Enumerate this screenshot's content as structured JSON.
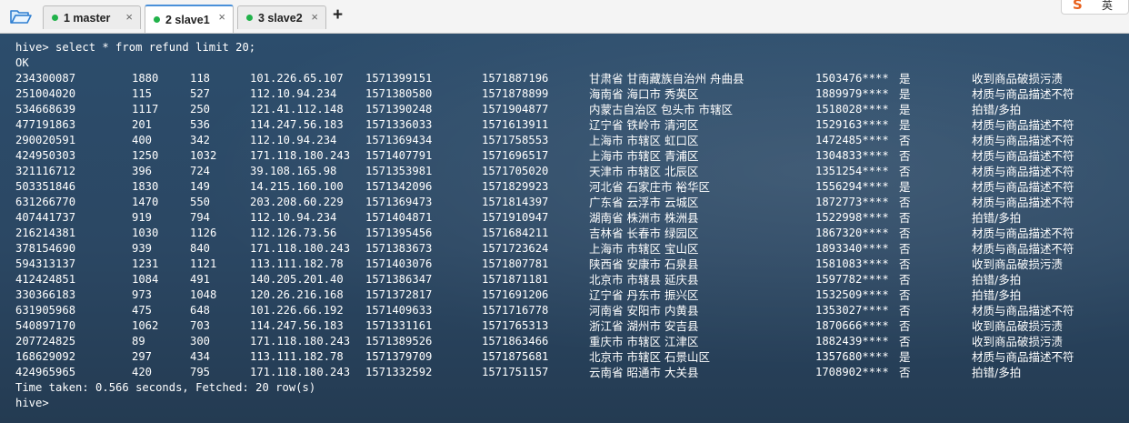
{
  "tabs": [
    {
      "label": "1 master",
      "status": "connected",
      "active": false
    },
    {
      "label": "2 slave1",
      "status": "connected",
      "active": true
    },
    {
      "label": "3 slave2",
      "status": "connected",
      "active": false
    }
  ],
  "tab_close_glyph": "×",
  "add_tab_glyph": "+",
  "ime_indicator": {
    "logo": "S",
    "text": "英"
  },
  "colors": {
    "status_dot": "#21b24a",
    "active_tab_accent": "#4a90d9",
    "terminal_bg": "#2a4560",
    "terminal_text": "#ffffff"
  },
  "terminal": {
    "command": "hive> select * from refund limit 20;",
    "ok": "OK",
    "rows": [
      [
        "234300087",
        "1880",
        "118",
        "101.226.65.107",
        "1571399151",
        "1571887196",
        "甘肃省 甘南藏族自治州 舟曲县",
        "1503476****",
        "是",
        "收到商品破损污渍"
      ],
      [
        "251004020",
        "115",
        "527",
        "112.10.94.234",
        "1571380580",
        "1571878899",
        "海南省 海口市 秀英区",
        "1889979****",
        "是",
        "材质与商品描述不符"
      ],
      [
        "534668639",
        "1117",
        "250",
        "121.41.112.148",
        "1571390248",
        "1571904877",
        "内蒙古自治区 包头市 市辖区",
        "1518028****",
        "是",
        "拍错/多拍"
      ],
      [
        "477191863",
        "201",
        "536",
        "114.247.56.183",
        "1571336033",
        "1571613911",
        "辽宁省 铁岭市 清河区",
        "1529163****",
        "是",
        "材质与商品描述不符"
      ],
      [
        "290020591",
        "400",
        "342",
        "112.10.94.234",
        "1571369434",
        "1571758553",
        "上海市 市辖区 虹口区",
        "1472485****",
        "否",
        "材质与商品描述不符"
      ],
      [
        "424950303",
        "1250",
        "1032",
        "171.118.180.243",
        "1571407791",
        "1571696517",
        "上海市 市辖区 青浦区",
        "1304833****",
        "否",
        "材质与商品描述不符"
      ],
      [
        "321116712",
        "396",
        "724",
        "39.108.165.98",
        "1571353981",
        "1571705020",
        "天津市 市辖区 北辰区",
        "1351254****",
        "否",
        "材质与商品描述不符"
      ],
      [
        "503351846",
        "1830",
        "149",
        "14.215.160.100",
        "1571342096",
        "1571829923",
        "河北省 石家庄市 裕华区",
        "1556294****",
        "是",
        "材质与商品描述不符"
      ],
      [
        "631266770",
        "1470",
        "550",
        "203.208.60.229",
        "1571369473",
        "1571814397",
        "广东省 云浮市 云城区",
        "1872773****",
        "否",
        "材质与商品描述不符"
      ],
      [
        "407441737",
        "919",
        "794",
        "112.10.94.234",
        "1571404871",
        "1571910947",
        "湖南省 株洲市 株洲县",
        "1522998****",
        "否",
        "拍错/多拍"
      ],
      [
        "216214381",
        "1030",
        "1126",
        "112.126.73.56",
        "1571395456",
        "1571684211",
        "吉林省 长春市 绿园区",
        "1867320****",
        "否",
        "材质与商品描述不符"
      ],
      [
        "378154690",
        "939",
        "840",
        "171.118.180.243",
        "1571383673",
        "1571723624",
        "上海市 市辖区 宝山区",
        "1893340****",
        "否",
        "材质与商品描述不符"
      ],
      [
        "594313137",
        "1231",
        "1121",
        "113.111.182.78",
        "1571403076",
        "1571807781",
        "陕西省 安康市 石泉县",
        "1581083****",
        "否",
        "收到商品破损污渍"
      ],
      [
        "412424851",
        "1084",
        "491",
        "140.205.201.40",
        "1571386347",
        "1571871181",
        "北京市 市辖县 延庆县",
        "1597782****",
        "否",
        "拍错/多拍"
      ],
      [
        "330366183",
        "973",
        "1048",
        "120.26.216.168",
        "1571372817",
        "1571691206",
        "辽宁省 丹东市 振兴区",
        "1532509****",
        "否",
        "拍错/多拍"
      ],
      [
        "631905968",
        "475",
        "648",
        "101.226.66.192",
        "1571409633",
        "1571716778",
        "河南省 安阳市 内黄县",
        "1353027****",
        "否",
        "材质与商品描述不符"
      ],
      [
        "540897170",
        "1062",
        "703",
        "114.247.56.183",
        "1571331161",
        "1571765313",
        "浙江省 湖州市 安吉县",
        "1870666****",
        "否",
        "收到商品破损污渍"
      ],
      [
        "207724825",
        "89",
        "300",
        "171.118.180.243",
        "1571389526",
        "1571863466",
        "重庆市 市辖区 江津区",
        "1882439****",
        "否",
        "收到商品破损污渍"
      ],
      [
        "168629092",
        "297",
        "434",
        "113.111.182.78",
        "1571379709",
        "1571875681",
        "北京市 市辖区 石景山区",
        "1357680****",
        "是",
        "材质与商品描述不符"
      ],
      [
        "424965965",
        "420",
        "795",
        "171.118.180.243",
        "1571332592",
        "1571751157",
        "云南省 昭通市 大关县",
        "1708902****",
        "否",
        "拍错/多拍"
      ]
    ],
    "time_taken": "Time taken: 0.566 seconds, Fetched: 20 row(s)",
    "prompt": "hive>"
  }
}
